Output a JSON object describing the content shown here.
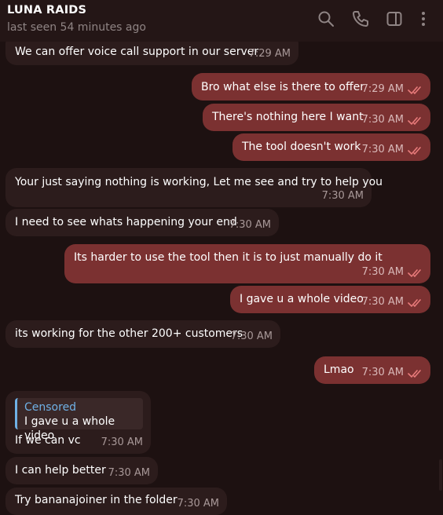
{
  "header": {
    "title": "LUNA RAIDS",
    "status": "last seen 54 minutes ago",
    "icons": [
      "search-icon",
      "phone-icon",
      "sidebar-toggle-icon",
      "more-vertical-icon"
    ]
  },
  "colors": {
    "background": "#1d1111",
    "incoming_bubble": "#2c1c1c",
    "outgoing_bubble": "#7b3131",
    "read_check": "#e87b7b",
    "reply_accent": "#6fb1e6"
  },
  "messages": [
    {
      "dir": "in",
      "text": "We can offer voice call support in our server",
      "time": "7:29 AM"
    },
    {
      "dir": "out",
      "text": "Bro what else is there to offer",
      "time": "7:29 AM",
      "read": true
    },
    {
      "dir": "out",
      "text": "There's nothing here I want",
      "time": "7:30 AM",
      "read": true
    },
    {
      "dir": "out",
      "text": "The tool doesn't work",
      "time": "7:30 AM",
      "read": true
    },
    {
      "dir": "in",
      "text": "Your just saying nothing is working, Let me see and try to help you",
      "time": "7:30 AM"
    },
    {
      "dir": "in",
      "text": "I need to see whats happening your end",
      "time": "7:30 AM"
    },
    {
      "dir": "out",
      "text": "Its harder to use the tool then it is to just manually do it",
      "time": "7:30 AM",
      "read": true
    },
    {
      "dir": "out",
      "text": "I gave u a whole video",
      "time": "7:30 AM",
      "read": true
    },
    {
      "dir": "in",
      "text": "its working for the other 200+ customers",
      "time": "7:30 AM"
    },
    {
      "dir": "out",
      "text": "Lmao",
      "time": "7:30 AM",
      "read": true
    },
    {
      "dir": "in",
      "text": "If we can vc",
      "time": "7:30 AM",
      "reply": {
        "name": "Censored",
        "text": "I gave u a whole video"
      }
    },
    {
      "dir": "in",
      "text": "I can help better",
      "time": "7:30 AM"
    },
    {
      "dir": "in",
      "text": "Try bananajoiner in the folder",
      "time": "7:30 AM"
    }
  ]
}
